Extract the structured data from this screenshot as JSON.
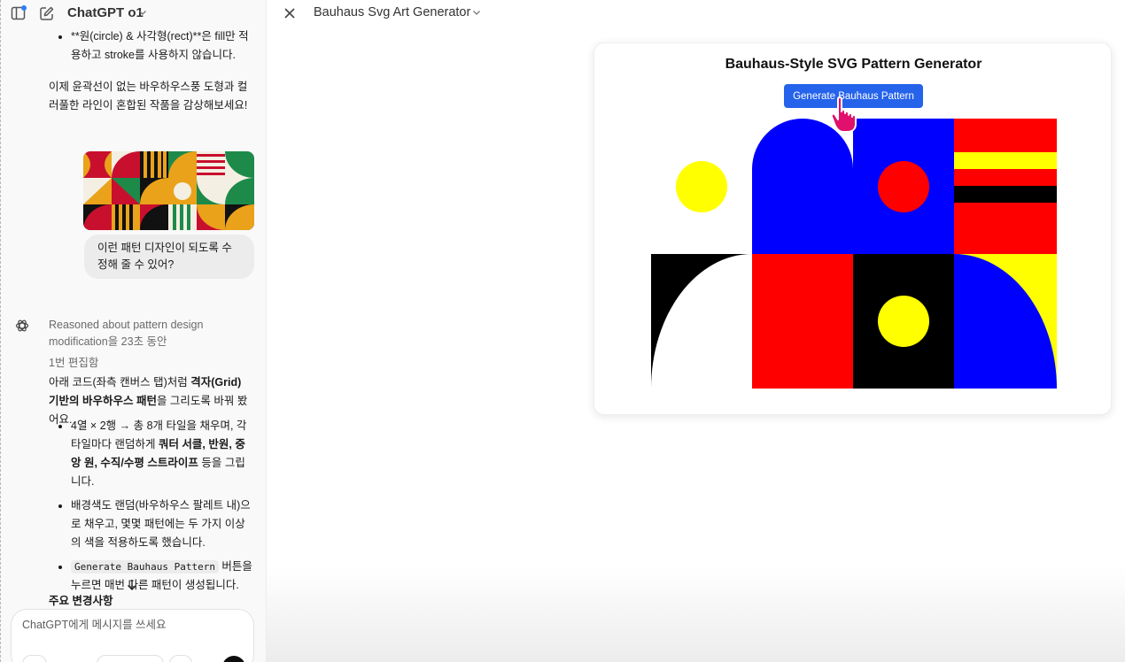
{
  "chat": {
    "model_title": "ChatGPT o1",
    "prior_bullet": "**원(circle) & 사각형(rect)**은 fill만 적용하고 stroke를 사용하지 않습니다.",
    "prior_paragraph": "이제 윤곽선이 없는 바우하우스풍 도형과 컬러풀한 라인이 혼합된 작품을 감상해보세요!",
    "user_message": "이런 패턴 디자인이 되도록 수정해 줄 수 있어?",
    "reasoning_label": "Reasoned about pattern design modification을 23초 동안",
    "edit_note": "1번 편집함",
    "intro": {
      "p1": "아래 코드(좌측 캔버스 탭)처럼 ",
      "b1": "격자(Grid) 기반의 바우하우스 패턴",
      "p2": "을 그리도록 바꿔 봤어요."
    },
    "bullet1": {
      "p1": "4열 × 2행 → 총 8개 타일을 채우며, 각 타일마다 랜덤하게 ",
      "b1": "쿼터 서클, 반원, 중앙 원, 수직/수평 스트라이프",
      "p2": " 등을 그립니다."
    },
    "bullet2": "배경색도 랜덤(바우하우스 팔레트 내)으로 채우고, 몇몇 패턴에는 두 가지 이상의 색을 적용하도록 했습니다.",
    "bullet3": {
      "code": "Generate Bauhaus Pattern",
      "p2": " 버튼을 누르면 매번 다른 패턴이 생성됩니다."
    },
    "section_heading": "주요 변경사항",
    "composer_placeholder": "ChatGPT에게 메시지를 쓰세요"
  },
  "canvas": {
    "title": "Bauhaus Svg Art Generator",
    "card_title": "Bauhaus-Style SVG Pattern Generator",
    "button_label": "Generate Bauhaus Pattern"
  },
  "palette": {
    "blue": "#0000ff",
    "red": "#ff0000",
    "yellow": "#ffff00",
    "black": "#000000",
    "white": "#ffffff",
    "button_blue": "#2563eb"
  },
  "icons": {
    "sidebar": "sidebar-toggle-icon",
    "new_chat": "new-chat-icon",
    "close": "close-icon",
    "assistant": "openai-logo-icon",
    "scroll": "arrow-down-icon",
    "cursor": "hand-pointer-icon"
  }
}
